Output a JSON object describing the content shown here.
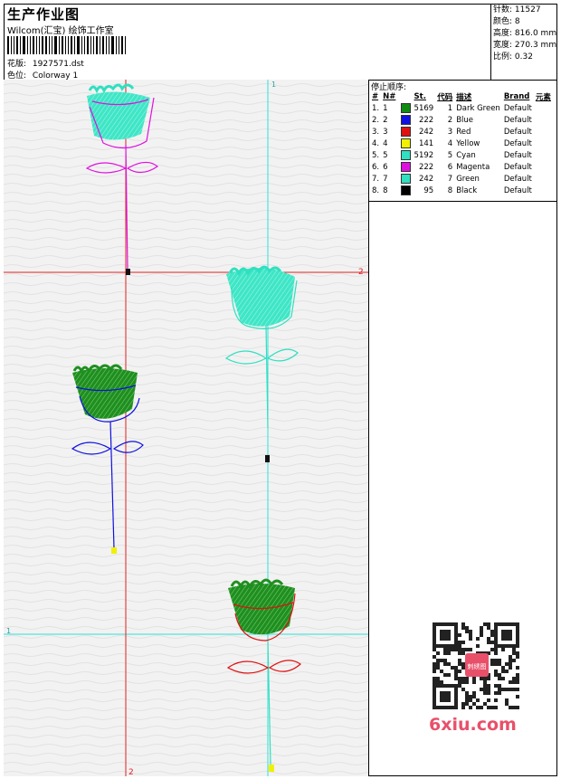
{
  "header": {
    "title": "生产作业图",
    "company": "Wilcom(汇宝) 绘饰工作室",
    "design_label": "花版:",
    "design_value": "1927571.dst",
    "colorway_label": "色位:",
    "colorway_value": "Colorway 1"
  },
  "stats": {
    "stitches_label": "针数:",
    "stitches_value": "11527",
    "colors_label": "颜色:",
    "colors_value": "8",
    "height_label": "高度:",
    "height_value": "816.0 mm",
    "width_label": "宽度:",
    "width_value": "270.3 mm",
    "scale_label": "比例:",
    "scale_value": "0.32"
  },
  "stop_sequence": {
    "heading": "停止顺序:",
    "columns": [
      "#",
      "N#",
      "St.",
      "代码",
      "描述",
      "Brand",
      "元素"
    ],
    "rows": [
      {
        "idx": "1.",
        "n": "1",
        "color": "#108a10",
        "st": "5169",
        "code": "1",
        "desc": "Dark Green",
        "brand": "Default"
      },
      {
        "idx": "2.",
        "n": "2",
        "color": "#1010e0",
        "st": "222",
        "code": "2",
        "desc": "Blue",
        "brand": "Default"
      },
      {
        "idx": "3.",
        "n": "3",
        "color": "#e01010",
        "st": "242",
        "code": "3",
        "desc": "Red",
        "brand": "Default"
      },
      {
        "idx": "4.",
        "n": "4",
        "color": "#f0f000",
        "st": "141",
        "code": "4",
        "desc": "Yellow",
        "brand": "Default"
      },
      {
        "idx": "5.",
        "n": "5",
        "color": "#30e0c0",
        "st": "5192",
        "code": "5",
        "desc": "Cyan",
        "brand": "Default"
      },
      {
        "idx": "6.",
        "n": "6",
        "color": "#e010e0",
        "st": "222",
        "code": "6",
        "desc": "Magenta",
        "brand": "Default"
      },
      {
        "idx": "7.",
        "n": "7",
        "color": "#30e0c0",
        "st": "242",
        "code": "7",
        "desc": "Green",
        "brand": "Default"
      },
      {
        "idx": "8.",
        "n": "8",
        "color": "#000000",
        "st": "95",
        "code": "8",
        "desc": "Black",
        "brand": "Default"
      }
    ]
  },
  "canvas": {
    "guide_labels": {
      "v_cyan": "1",
      "h_red": "2",
      "h_cyan": "1",
      "v_red": "2"
    }
  },
  "watermark": {
    "text": "6xiu.com",
    "qr_text": "刺绣图"
  }
}
